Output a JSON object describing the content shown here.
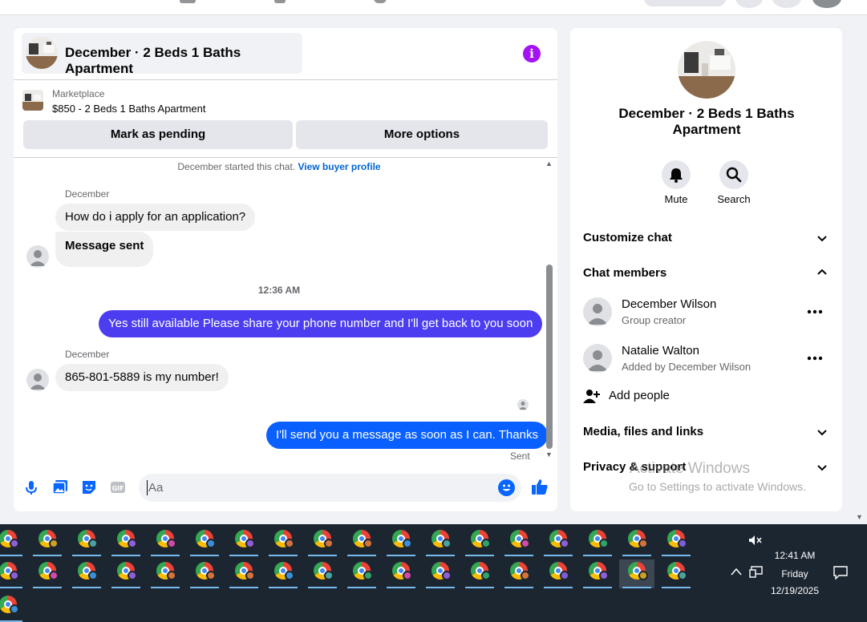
{
  "chat": {
    "title": "December · 2 Beds 1 Baths Apartment",
    "listing": {
      "label": "Marketplace",
      "title": "$850 - 2 Beds 1 Baths Apartment"
    },
    "buttons": {
      "mark_pending": "Mark as pending",
      "more_options": "More options"
    },
    "started_text": "December started this chat.",
    "buyer_profile_link": "View buyer profile",
    "messages": [
      {
        "sender": "December",
        "text": "How do i apply for an application?"
      },
      {
        "text": "Message sent"
      },
      {
        "timestamp": "12:36 AM"
      },
      {
        "outgoing": true,
        "text": "Yes still available Please share your phone number and I'll get back to you soon"
      },
      {
        "sender": "December",
        "text": "865-801-5889 is my number!"
      },
      {
        "outgoing": true,
        "text": "I'll send you a message as soon as I can. Thanks"
      }
    ],
    "sent_status": "Sent",
    "composer_placeholder": "Aa",
    "colors": {
      "outgoing_1": "#4c3ef0",
      "outgoing_2": "#0a60ff",
      "accent": "#0866ff"
    }
  },
  "info": {
    "title": "December · 2 Beds 1 Baths Apartment",
    "actions": {
      "mute": "Mute",
      "search": "Search"
    },
    "sections": {
      "customize": "Customize chat",
      "members": "Chat members",
      "media": "Media, files and links",
      "privacy": "Privacy & support"
    },
    "members": [
      {
        "name": "December Wilson",
        "role": "Group creator"
      },
      {
        "name": "Natalie Walton",
        "role": "Added by December Wilson"
      }
    ],
    "add_people": "Add people"
  },
  "watermark": {
    "line1": "Activate Windows",
    "line2": "Go to Settings to activate Windows."
  },
  "taskbar": {
    "time": "12:41 AM",
    "day": "Friday",
    "date": "12/19/2025",
    "icon_name": "chrome-profile-icon"
  }
}
